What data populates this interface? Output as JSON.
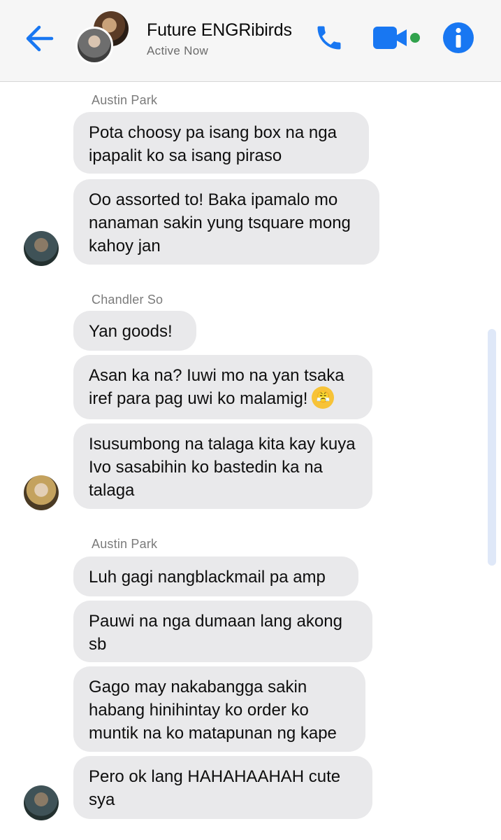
{
  "header": {
    "title": "Future ENGRibirds",
    "status": "Active Now",
    "icons": {
      "back": "back-arrow-icon",
      "phone": "phone-icon",
      "video": "video-camera-icon",
      "info": "info-icon"
    },
    "accent_color": "#1877f2",
    "online_color": "#31a24c"
  },
  "groups": [
    {
      "sender": "Austin Park",
      "messages": [
        "Pota choosy pa isang box na nga ipapalit ko sa isang piraso",
        "Oo assorted to! Baka ipamalo mo nanaman sakin yung tsquare mong kahoy jan"
      ]
    },
    {
      "sender": "Chandler So",
      "messages": [
        "Yan goods!",
        "Asan ka na? Iuwi mo na yan tsaka iref para pag uwi ko malamig!",
        "Isusumbong na talaga kita kay kuya Ivo sasabihin ko bastedin ka na talaga"
      ],
      "emoji": "😤"
    },
    {
      "sender": "Austin Park",
      "messages": [
        "Luh gagi nangblackmail pa amp",
        "Pauwi na nga dumaan lang akong sb",
        "Gago may nakabangga sakin habang hinihintay ko order ko muntik na ko matapunan ng kape",
        "Pero ok lang HAHAHAAHAH cute sya"
      ]
    }
  ]
}
